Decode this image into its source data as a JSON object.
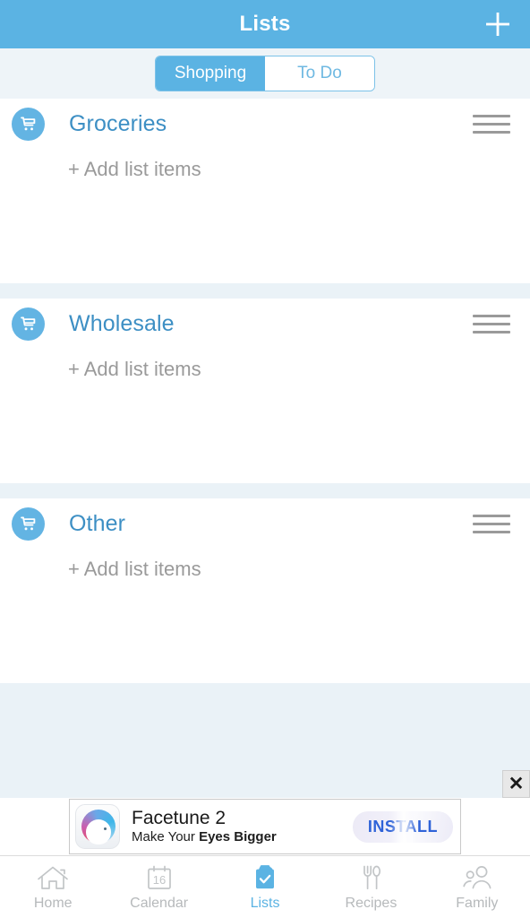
{
  "header": {
    "title": "Lists",
    "add_icon": "plus-icon",
    "bg_color": "#5bb3e3"
  },
  "segmented": {
    "options": [
      {
        "label": "Shopping",
        "selected": true
      },
      {
        "label": "To Do",
        "selected": false
      }
    ],
    "active_color": "#5bb3e3",
    "inactive_color": "#6fb9e2"
  },
  "lists": [
    {
      "icon": "shopping-cart-icon",
      "title": "Groceries",
      "placeholder": "+ Add list items",
      "handle_icon": "drag-handle-icon"
    },
    {
      "icon": "shopping-cart-icon",
      "title": "Wholesale",
      "placeholder": "+ Add list items",
      "handle_icon": "drag-handle-icon"
    },
    {
      "icon": "shopping-cart-icon",
      "title": "Other",
      "placeholder": "+ Add list items",
      "handle_icon": "drag-handle-icon"
    }
  ],
  "ad": {
    "close_label": "✕",
    "app_icon": "facetune-app-icon",
    "title": "Facetune 2",
    "subtitle_normal": "Make Your ",
    "subtitle_bold": "Eyes Bigger",
    "cta_label": "INSTALL",
    "cta_color": "#2f63d8"
  },
  "tabbar": {
    "items": [
      {
        "label": "Home",
        "icon": "home-icon",
        "active": false
      },
      {
        "label": "Calendar",
        "icon": "calendar-icon",
        "day": "16",
        "active": false
      },
      {
        "label": "Lists",
        "icon": "clipboard-check-icon",
        "active": true
      },
      {
        "label": "Recipes",
        "icon": "fork-spoon-icon",
        "active": false
      },
      {
        "label": "Family",
        "icon": "people-icon",
        "active": false
      }
    ],
    "active_color": "#5bb3e3",
    "inactive_color": "#b6b9bb"
  }
}
